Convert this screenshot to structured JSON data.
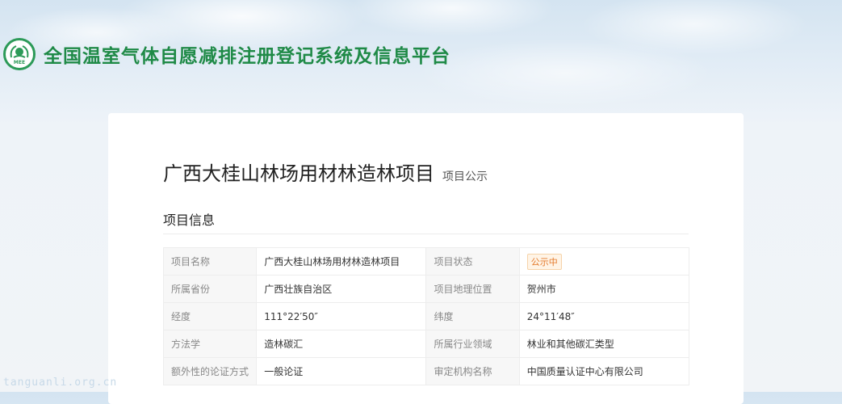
{
  "header": {
    "logo_text": "MEE",
    "title": "全国温室气体自愿减排注册登记系统及信息平台"
  },
  "project": {
    "title": "广西大桂山林场用材林造林项目",
    "subtitle": "项目公示"
  },
  "section": {
    "title": "项目信息"
  },
  "info_rows": [
    {
      "label1": "项目名称",
      "value1": "广西大桂山林场用材林造林项目",
      "label2": "项目状态",
      "value2": "公示中"
    },
    {
      "label1": "所属省份",
      "value1": "广西壮族自治区",
      "label2": "项目地理位置",
      "value2": "贺州市"
    },
    {
      "label1": "经度",
      "value1": "111°22′50″",
      "label2": "纬度",
      "value2": "24°11′48″"
    },
    {
      "label1": "方法学",
      "value1": "造林碳汇",
      "label2": "所属行业领域",
      "value2": "林业和其他碳汇类型"
    },
    {
      "label1": "额外性的论证方式",
      "value1": "一般论证",
      "label2": "审定机构名称",
      "value2": "中国质量认证中心有限公司"
    }
  ],
  "watermark": "tanguanli.org.cn",
  "colors": {
    "brand_green": "#1f8a47",
    "status_orange": "#e47a2c"
  }
}
